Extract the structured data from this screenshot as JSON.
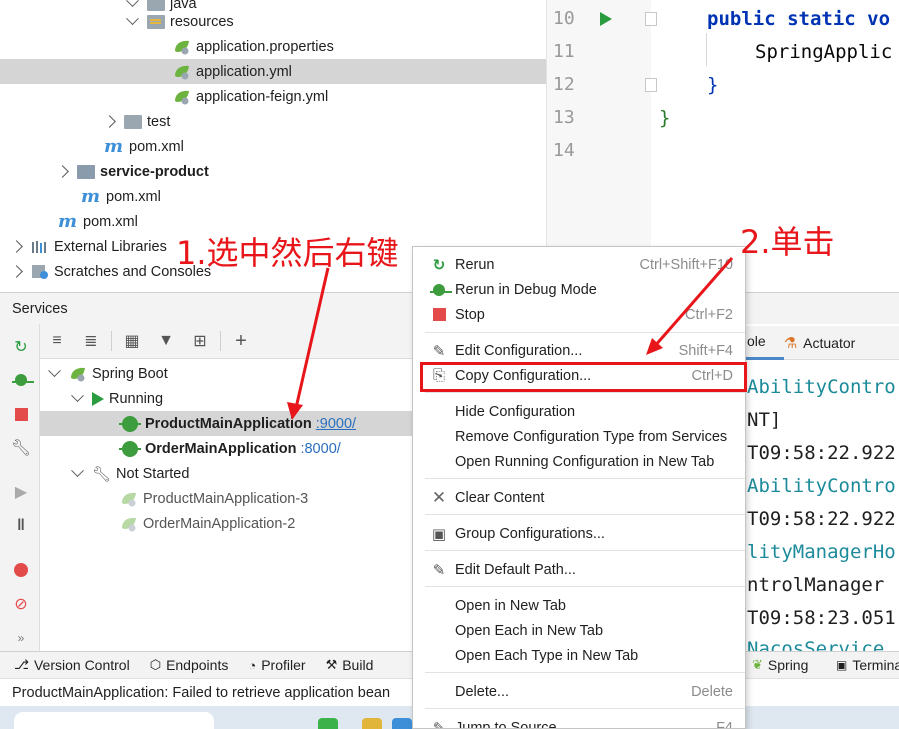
{
  "project_tree": {
    "items": [
      {
        "label": "java",
        "kind": "folder"
      },
      {
        "label": "resources",
        "kind": "resources-folder"
      },
      {
        "label": "application.properties",
        "kind": "spring-config"
      },
      {
        "label": "application.yml",
        "kind": "spring-config"
      },
      {
        "label": "application-feign.yml",
        "kind": "spring-config"
      },
      {
        "label": "test",
        "kind": "folder"
      },
      {
        "label": "pom.xml",
        "kind": "maven"
      },
      {
        "label": "service-product",
        "kind": "module"
      },
      {
        "label": "pom.xml",
        "kind": "maven"
      },
      {
        "label": "pom.xml",
        "kind": "maven"
      },
      {
        "label": "External Libraries",
        "kind": "libraries"
      },
      {
        "label": "Scratches and Consoles",
        "kind": "scratches"
      }
    ]
  },
  "editor": {
    "lines": [
      {
        "num": "10",
        "kw": "public static ",
        "text": "vo"
      },
      {
        "num": "11",
        "kw": "",
        "text": "SpringApplic"
      },
      {
        "num": "12",
        "kw": "",
        "text": "}"
      },
      {
        "num": "13",
        "kw": "",
        "text": "}"
      },
      {
        "num": "14",
        "kw": "",
        "text": ""
      }
    ]
  },
  "services": {
    "title": "Services",
    "tree": [
      {
        "label": "Spring Boot"
      },
      {
        "label": "Running"
      },
      {
        "label": "ProductMainApplication",
        "port": ":9000/"
      },
      {
        "label": "OrderMainApplication",
        "port": ":8000/"
      },
      {
        "label": "Not Started"
      },
      {
        "label": "ProductMainApplication-3"
      },
      {
        "label": "OrderMainApplication-2"
      }
    ]
  },
  "console": {
    "tabs": [
      "ole",
      "Actuator"
    ],
    "lines": [
      {
        "text": "AbilityContro",
        "color": "#1b8a9a"
      },
      {
        "text": "NT]",
        "color": "#1f1f1f"
      },
      {
        "text": "T09:58:22.922",
        "color": "#1f1f1f"
      },
      {
        "text": "AbilityContro",
        "color": "#1b8a9a"
      },
      {
        "text": "T09:58:22.922",
        "color": "#1f1f1f"
      },
      {
        "text": "lityManagerHo",
        "color": "#1b8a9a"
      },
      {
        "text": "ntrolManager",
        "color": "#1f1f1f"
      },
      {
        "text": "T09:58:23.051",
        "color": "#1f1f1f"
      },
      {
        "text": "NacosService",
        "color": "#1b8a9a"
      }
    ]
  },
  "context_menu": {
    "items": [
      {
        "label": "Rerun",
        "shortcut": "Ctrl+Shift+F10",
        "icon": "rerun-icon"
      },
      {
        "label": "Rerun in Debug Mode",
        "shortcut": "",
        "icon": "debug-icon"
      },
      {
        "label": "Stop",
        "shortcut": "Ctrl+F2",
        "icon": "stop-icon"
      },
      {
        "label": "Edit Configuration...",
        "shortcut": "Shift+F4",
        "icon": "edit-icon"
      },
      {
        "label": "Copy Configuration...",
        "shortcut": "Ctrl+D",
        "icon": "copy-icon"
      },
      {
        "label": "Hide Configuration",
        "shortcut": "",
        "icon": ""
      },
      {
        "label": "Remove Configuration Type from Services",
        "shortcut": "",
        "icon": ""
      },
      {
        "label": "Open Running Configuration in New Tab",
        "shortcut": "",
        "icon": ""
      },
      {
        "label": "Clear Content",
        "shortcut": "",
        "icon": "close-icon"
      },
      {
        "label": "Group Configurations...",
        "shortcut": "",
        "icon": "group-icon"
      },
      {
        "label": "Edit Default Path...",
        "shortcut": "",
        "icon": "edit-icon"
      },
      {
        "label": "Open in New Tab",
        "shortcut": "",
        "icon": ""
      },
      {
        "label": "Open Each in New Tab",
        "shortcut": "",
        "icon": ""
      },
      {
        "label": "Open Each Type in New Tab",
        "shortcut": "",
        "icon": ""
      },
      {
        "label": "Delete...",
        "shortcut": "Delete",
        "icon": ""
      },
      {
        "label": "Jump to Source",
        "shortcut": "F4",
        "icon": "jump-icon"
      }
    ]
  },
  "bottom_tabs": [
    {
      "label": "Version Control",
      "icon": "vcs-icon"
    },
    {
      "label": "Endpoints",
      "icon": "endpoints-icon"
    },
    {
      "label": "Profiler",
      "icon": "profiler-icon"
    },
    {
      "label": "Build",
      "icon": "hammer-icon"
    },
    {
      "label": "Spring",
      "icon": "spring-icon"
    },
    {
      "label": "Termina",
      "icon": "terminal-icon"
    }
  ],
  "status_bar": {
    "message": "ProductMainApplication: Failed to retrieve application bean"
  },
  "annotations": {
    "step1": "1.选中然后右键",
    "step2": "2.单击"
  },
  "colors": {
    "annotation_red": "#e8161a",
    "selection_gray": "#d5d5d5",
    "run_green": "#2b9b3f",
    "link_blue": "#2a6fbd",
    "keyword_blue": "#0033b3"
  }
}
